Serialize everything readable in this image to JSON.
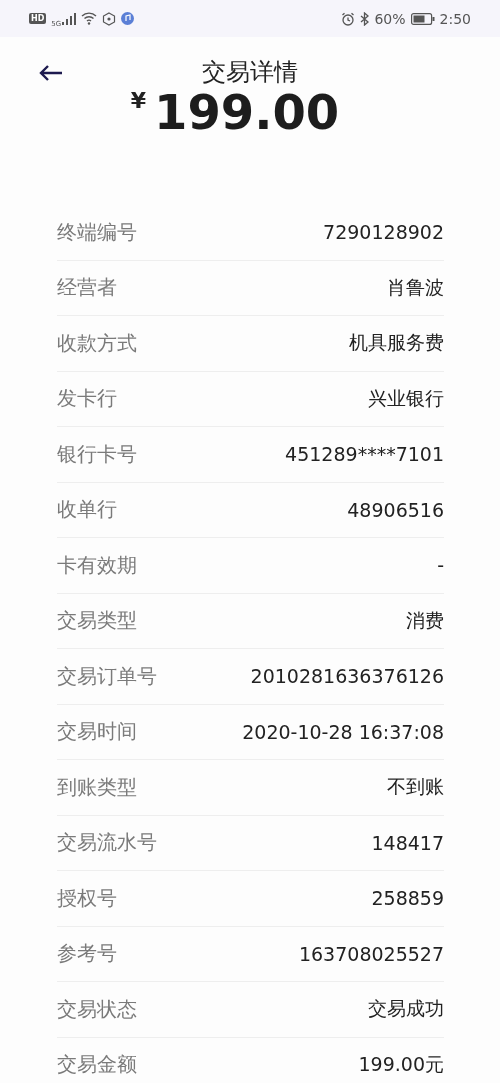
{
  "status_bar": {
    "hd": "HD",
    "network": "5G",
    "battery": "60%",
    "time": "2:50"
  },
  "header": {
    "title": "交易详情",
    "currency": "¥",
    "amount": "199.00"
  },
  "rows": [
    {
      "label": "终端编号",
      "value": "7290128902"
    },
    {
      "label": "经营者",
      "value": "肖鲁波"
    },
    {
      "label": "收款方式",
      "value": "机具服务费"
    },
    {
      "label": "发卡行",
      "value": "兴业银行"
    },
    {
      "label": "银行卡号",
      "value": "451289****7101"
    },
    {
      "label": "收单行",
      "value": "48906516"
    },
    {
      "label": "卡有效期",
      "value": "-"
    },
    {
      "label": "交易类型",
      "value": "消费"
    },
    {
      "label": "交易订单号",
      "value": "2010281636376126"
    },
    {
      "label": "交易时间",
      "value": "2020-10-28 16:37:08"
    },
    {
      "label": "到账类型",
      "value": "不到账"
    },
    {
      "label": "交易流水号",
      "value": "148417"
    },
    {
      "label": "授权号",
      "value": "258859"
    },
    {
      "label": "参考号",
      "value": "163708025527"
    },
    {
      "label": "交易状态",
      "value": "交易成功"
    },
    {
      "label": "交易金额",
      "value": "199.00元"
    }
  ]
}
